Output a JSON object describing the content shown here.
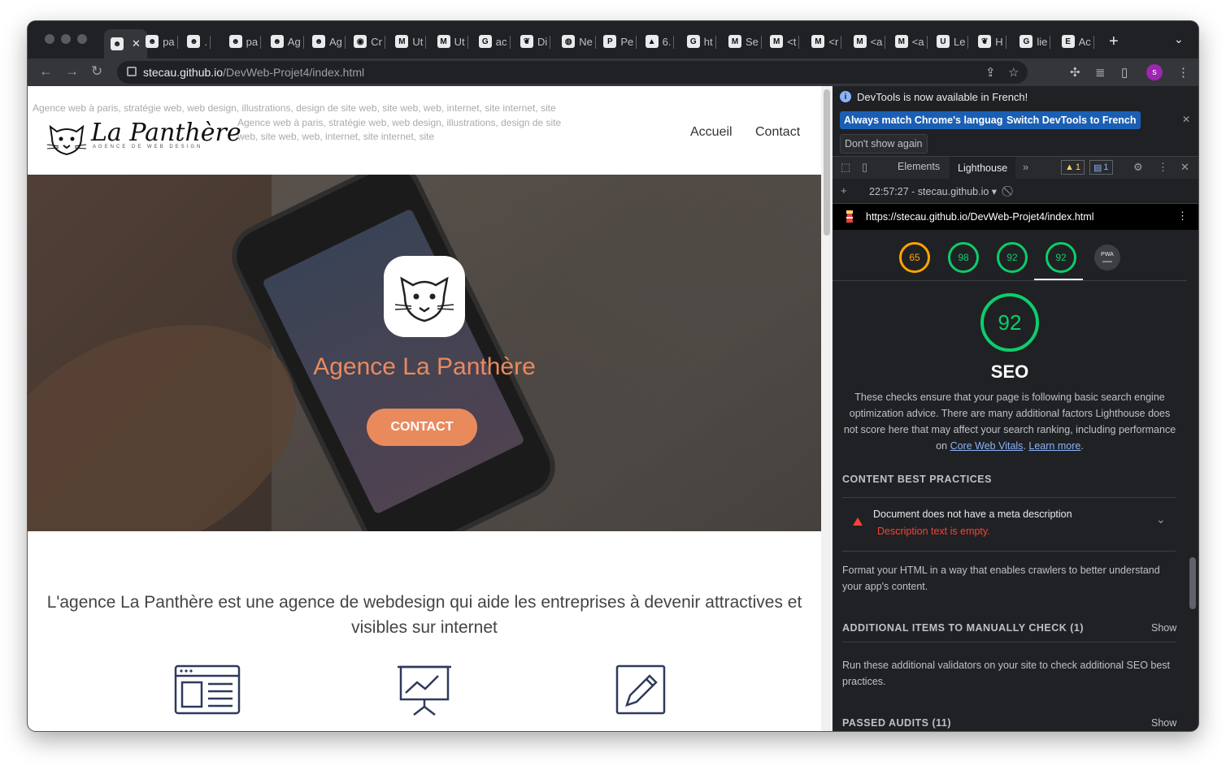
{
  "browser": {
    "tabs": [
      {
        "label": "",
        "icon": "panther-favicon",
        "active": true
      },
      {
        "label": "pa",
        "icon": "panther-favicon"
      },
      {
        "label": ".",
        "icon": "panther-favicon"
      },
      {
        "label": "pa",
        "icon": "panther-favicon"
      },
      {
        "label": "Ag",
        "icon": "panther-favicon"
      },
      {
        "label": "Ag",
        "icon": "panther-favicon"
      },
      {
        "label": "Cr",
        "icon": "chrome-favicon"
      },
      {
        "label": "Ut",
        "icon": "m-favicon"
      },
      {
        "label": "Ut",
        "icon": "m-favicon"
      },
      {
        "label": "ac",
        "icon": "google-favicon"
      },
      {
        "label": "Di",
        "icon": "leaf-favicon"
      },
      {
        "label": "Ne",
        "icon": "globe-favicon"
      },
      {
        "label": "Pe",
        "icon": "p-favicon"
      },
      {
        "label": "6.",
        "icon": "a-favicon"
      },
      {
        "label": "ht",
        "icon": "google-favicon"
      },
      {
        "label": "Se",
        "icon": "m-favicon"
      },
      {
        "label": "<t",
        "icon": "m-favicon"
      },
      {
        "label": "<r",
        "icon": "m-favicon"
      },
      {
        "label": "<a",
        "icon": "m-favicon"
      },
      {
        "label": "<a",
        "icon": "m-favicon"
      },
      {
        "label": "Le",
        "icon": "u-favicon"
      },
      {
        "label": "H",
        "icon": "leaf-favicon"
      },
      {
        "label": "lie",
        "icon": "google-favicon"
      },
      {
        "label": "Ac",
        "icon": "e-favicon"
      }
    ],
    "url_host": "stecau.github.io",
    "url_path": "/DevWeb-Projet4/index.html",
    "avatar_letter": "s"
  },
  "site": {
    "seo_text_1": "Agence web à paris, stratégie web, web design, illustrations, design de site web, site web, web, internet, site internet, site",
    "seo_text_2": "Agence web à paris, stratégie web, web design, illustrations, design de site web, site web, web, internet, site internet, site",
    "logo_text": "La Panthère",
    "logo_subtitle": "AGENCE DE WEB DESIGN",
    "nav": [
      "Accueil",
      "Contact"
    ],
    "hero_title": "Agence La Panthère",
    "hero_button": "CONTACT",
    "tagline": "L'agence La Panthère est une agence de webdesign qui aide les entreprises à devenir attractives et visibles sur internet"
  },
  "devtools": {
    "info_message": "DevTools is now available in French!",
    "btn_match": "Always match Chrome's language",
    "btn_switch": "Switch DevTools to French",
    "btn_dont_show": "Don't show again",
    "tabs": [
      "Elements",
      "Lighthouse"
    ],
    "warning_count": "1",
    "message_count": "1",
    "report_label": "22:57:27 - stecau.github.io",
    "report_url": "https://stecau.github.io/DevWeb-Projet4/index.html",
    "scores": [
      65,
      98,
      92,
      92
    ],
    "pwa_label": "PWA",
    "seo_score": "92",
    "category_title": "SEO",
    "category_desc": "These checks ensure that your page is following basic search engine optimization advice. There are many additional factors Lighthouse does not score here that may affect your search ranking, including performance on",
    "link_cwv": "Core Web Vitals",
    "link_learn": "Learn more",
    "group_content": "CONTENT BEST PRACTICES",
    "audit_title": "Document does not have a meta description",
    "audit_error": "Description text is empty.",
    "content_desc": "Format your HTML in a way that enables crawlers to better understand your app's content.",
    "group_manual": "ADDITIONAL ITEMS TO MANUALLY CHECK (1)",
    "show_label": "Show",
    "manual_desc": "Run these additional validators on your site to check additional SEO best practices.",
    "group_passed": "PASSED AUDITS (11)",
    "colors": {
      "pass": "#0cce6b",
      "average": "#ffa400",
      "fail": "#f44336",
      "link": "#8ab4f8"
    }
  }
}
